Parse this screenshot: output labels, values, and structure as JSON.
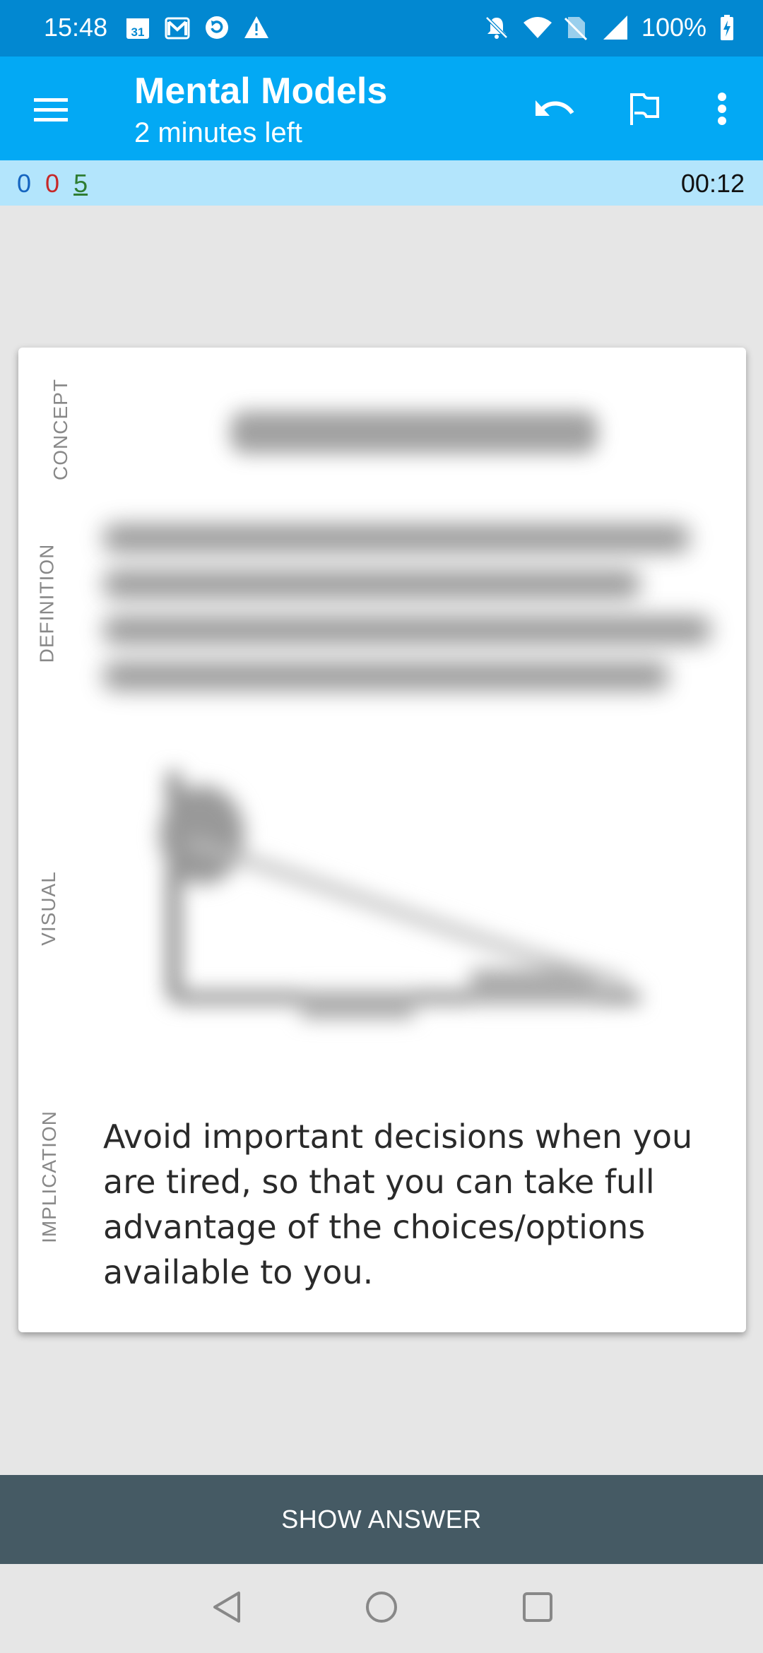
{
  "status_bar": {
    "time": "15:48",
    "calendar_day": "31",
    "battery": "100%"
  },
  "app_bar": {
    "title": "Mental Models",
    "subtitle": "2 minutes left"
  },
  "counts": {
    "new": "0",
    "learning": "0",
    "review": "5",
    "timer": "00:12"
  },
  "card": {
    "sections": {
      "concept": "CONCEPT",
      "definition": "DEFINITION",
      "visual": "VISUAL",
      "implication": "IMPLICATION"
    },
    "implication_text": "Avoid important decisions when you are tired, so that you can take full advantage of the choices/options available to you."
  },
  "show_answer_label": "SHOW ANSWER",
  "icons": {
    "menu": "menu-icon",
    "undo": "undo-icon",
    "flag": "flag-icon",
    "more": "more-vert-icon",
    "back": "back-icon",
    "home": "home-icon",
    "recents": "recents-icon"
  },
  "colors": {
    "status_bar": "#0288d1",
    "app_bar": "#03a9f4",
    "counts_bar": "#b3e5fc",
    "show_answer": "#455a64"
  }
}
